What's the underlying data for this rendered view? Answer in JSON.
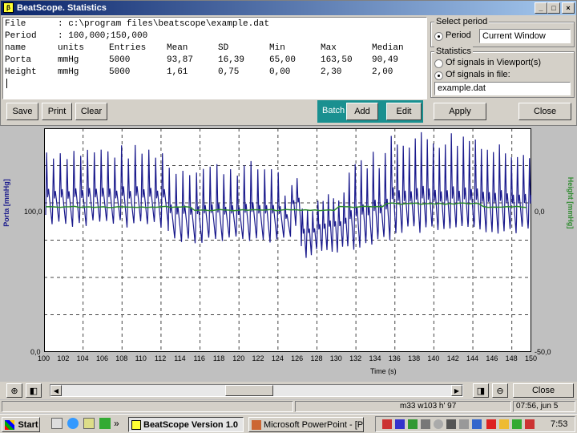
{
  "window": {
    "title": "BeatScope. Statistics",
    "minimize_glyph": "_",
    "maximize_glyph": "□",
    "close_glyph": "×"
  },
  "stats": {
    "file_label": "File",
    "file_value": ": c:\\program files\\beatscope\\example.dat",
    "period_label": "Period",
    "period_value": ": 100,000;150,000",
    "headers": [
      "name",
      "units",
      "Entries",
      "Mean",
      "SD",
      "Min",
      "Max",
      "Median"
    ],
    "rows": [
      [
        "Porta",
        "mmHg",
        "5000",
        "93,87",
        "16,39",
        "65,00",
        "163,50",
        "90,49"
      ],
      [
        "Height",
        "mmHg",
        "5000",
        "1,61",
        "0,75",
        "0,00",
        "2,30",
        "2,00"
      ]
    ]
  },
  "select_period": {
    "label": "Select period",
    "radio_label": "Period",
    "dropdown_value": "Current Window"
  },
  "statistics_group": {
    "label": "Statistics",
    "option1": "Of signals in Viewport(s)",
    "option2": "Of signals in file:",
    "file_field": "example.dat"
  },
  "buttons": {
    "save": "Save",
    "print": "Print",
    "clear": "Clear",
    "batch": "Batch",
    "add": "Add",
    "edit": "Edit",
    "apply": "Apply",
    "close": "Close"
  },
  "chart_data": {
    "type": "line",
    "xlabel": "Time (s)",
    "ylabel_left": "Porta [mmHg]",
    "ylabel_right": "Height [mmHg]",
    "x_ticks": [
      "100",
      "102",
      "104",
      "106",
      "108",
      "110",
      "112",
      "114",
      "116",
      "118",
      "120",
      "122",
      "124",
      "126",
      "128",
      "130",
      "132",
      "134",
      "136",
      "138",
      "140",
      "142",
      "144",
      "146",
      "148",
      "150"
    ],
    "xlim": [
      100,
      150
    ],
    "left_ticks": [
      "100,0",
      "0,0"
    ],
    "right_ticks": [
      "0,0",
      "-50,0"
    ],
    "grid": true,
    "series": [
      {
        "name": "Porta",
        "color": "#1a1a8c"
      },
      {
        "name": "Height",
        "color": "#2e8b2e"
      }
    ]
  },
  "bottom_toolbar": {
    "close": "Close"
  },
  "status": {
    "center_text": "m33 w103 h' 97",
    "right_text": "07:56, jun 5"
  },
  "taskbar": {
    "start": "Start",
    "task1": "BeatScope Version 1.0",
    "task2": "Microsoft PowerPoint - [Po...",
    "clock": "7:53"
  }
}
